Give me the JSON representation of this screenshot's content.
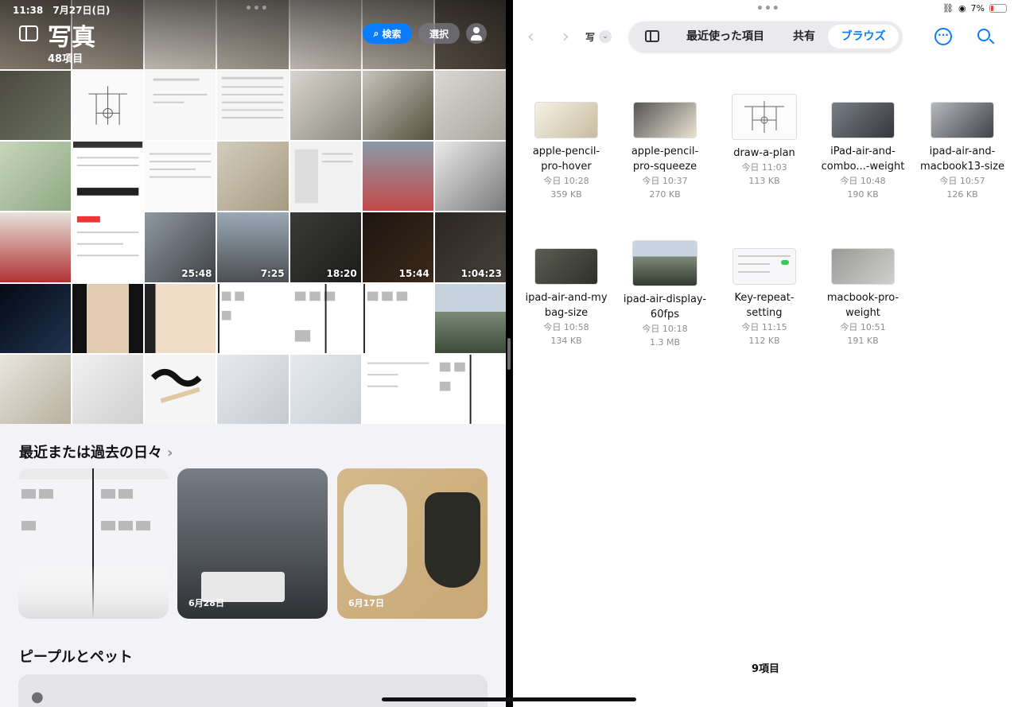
{
  "status": {
    "time": "11:38",
    "date": "7月27日(日)",
    "battery": "7%"
  },
  "photos": {
    "title": "写真",
    "count": "48項目",
    "search_label": "検索",
    "select_label": "選択",
    "video_durations": [
      "25:48",
      "7:25",
      "18:20",
      "15:44",
      "1:04:23"
    ],
    "recent_days_title": "最近または過去の日々",
    "memories": [
      {
        "date": ""
      },
      {
        "date": "6月28日"
      },
      {
        "date": "6月17日"
      }
    ],
    "people_title": "ピープルとペット"
  },
  "files": {
    "location": "写",
    "tabs": [
      "最近使った項目",
      "共有",
      "ブラウズ"
    ],
    "active_tab": "ブラウズ",
    "items": [
      {
        "name": "apple-pencil-pro-hover",
        "date": "今日 10:28",
        "size": "359 KB"
      },
      {
        "name": "apple-pencil-pro-squeeze",
        "date": "今日 10:37",
        "size": "270 KB"
      },
      {
        "name": "draw-a-plan",
        "date": "今日 11:03",
        "size": "113 KB"
      },
      {
        "name": "iPad-air-and-combo...-weight",
        "date": "今日 10:48",
        "size": "190 KB"
      },
      {
        "name": "ipad-air-and-macbook13-size",
        "date": "今日 10:57",
        "size": "126 KB"
      },
      {
        "name": "ipad-air-and-my bag-size",
        "date": "今日 10:58",
        "size": "134 KB"
      },
      {
        "name": "ipad-air-display-60fps",
        "date": "今日 10:18",
        "size": "1.3 MB"
      },
      {
        "name": "Key-repeat-setting",
        "date": "今日 11:15",
        "size": "112 KB"
      },
      {
        "name": "macbook-pro-weight",
        "date": "今日 10:51",
        "size": "191 KB"
      }
    ],
    "item_count": "9項目"
  }
}
